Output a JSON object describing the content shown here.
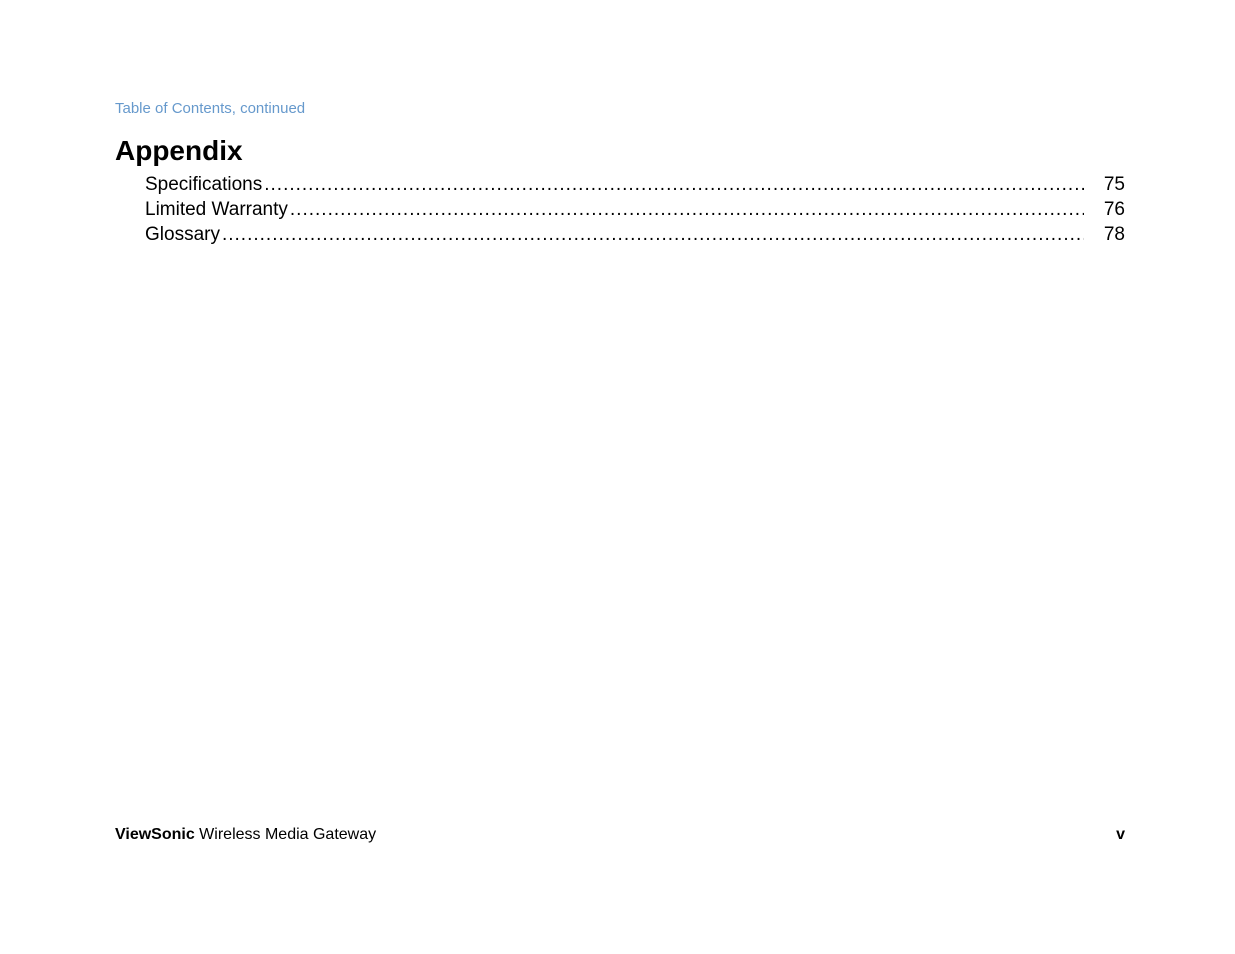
{
  "header_note": "Table of Contents, continued",
  "section_title": "Appendix",
  "entries": [
    {
      "label": "Specifications",
      "page": "75"
    },
    {
      "label": "Limited Warranty",
      "page": "76"
    },
    {
      "label": "Glossary",
      "page": "78"
    }
  ],
  "footer": {
    "brand": "ViewSonic",
    "product": " Wireless Media Gateway",
    "page_number": "v"
  }
}
